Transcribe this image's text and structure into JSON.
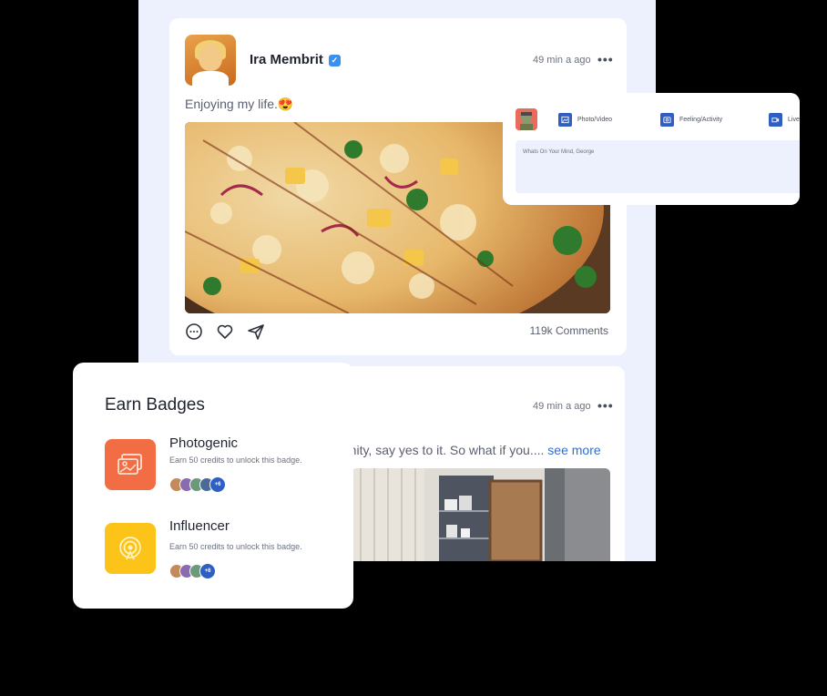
{
  "post1": {
    "author": "Ira Membrit",
    "verified_mark": "✓",
    "time": "49 min a ago",
    "menu": "•••",
    "text": "Enjoying my life.😍",
    "comments": "119k Comments",
    "icons": [
      "comment-icon",
      "heart-icon",
      "share-icon"
    ]
  },
  "post2": {
    "time": "49 min a ago",
    "menu": "•••",
    "text": "tunity, say yes to it. So what if you....",
    "see_more": "see more"
  },
  "composer": {
    "options": [
      {
        "label": "Photo/Video",
        "icon": "image-icon"
      },
      {
        "label": "Feeling/Activity",
        "icon": "emoji-icon"
      },
      {
        "label": "Live",
        "icon": "video-icon"
      }
    ],
    "placeholder": "Whats On Your Mind, George"
  },
  "badges": {
    "title": "Earn Badges",
    "items": [
      {
        "name": "Photogenic",
        "desc": "Earn 50 credits to unlock this badge.",
        "more": "+6",
        "color": "#f26d43",
        "icon": "photo-badge-icon"
      },
      {
        "name": "Influencer",
        "desc": "Earn 50 credits to unlock this badge.",
        "more": "+6",
        "color": "#fcc419",
        "icon": "broadcast-badge-icon"
      }
    ]
  },
  "colors": {
    "accent": "#2f5fc2",
    "feed_background": "#edf1fd",
    "link": "#2f6fd1"
  }
}
